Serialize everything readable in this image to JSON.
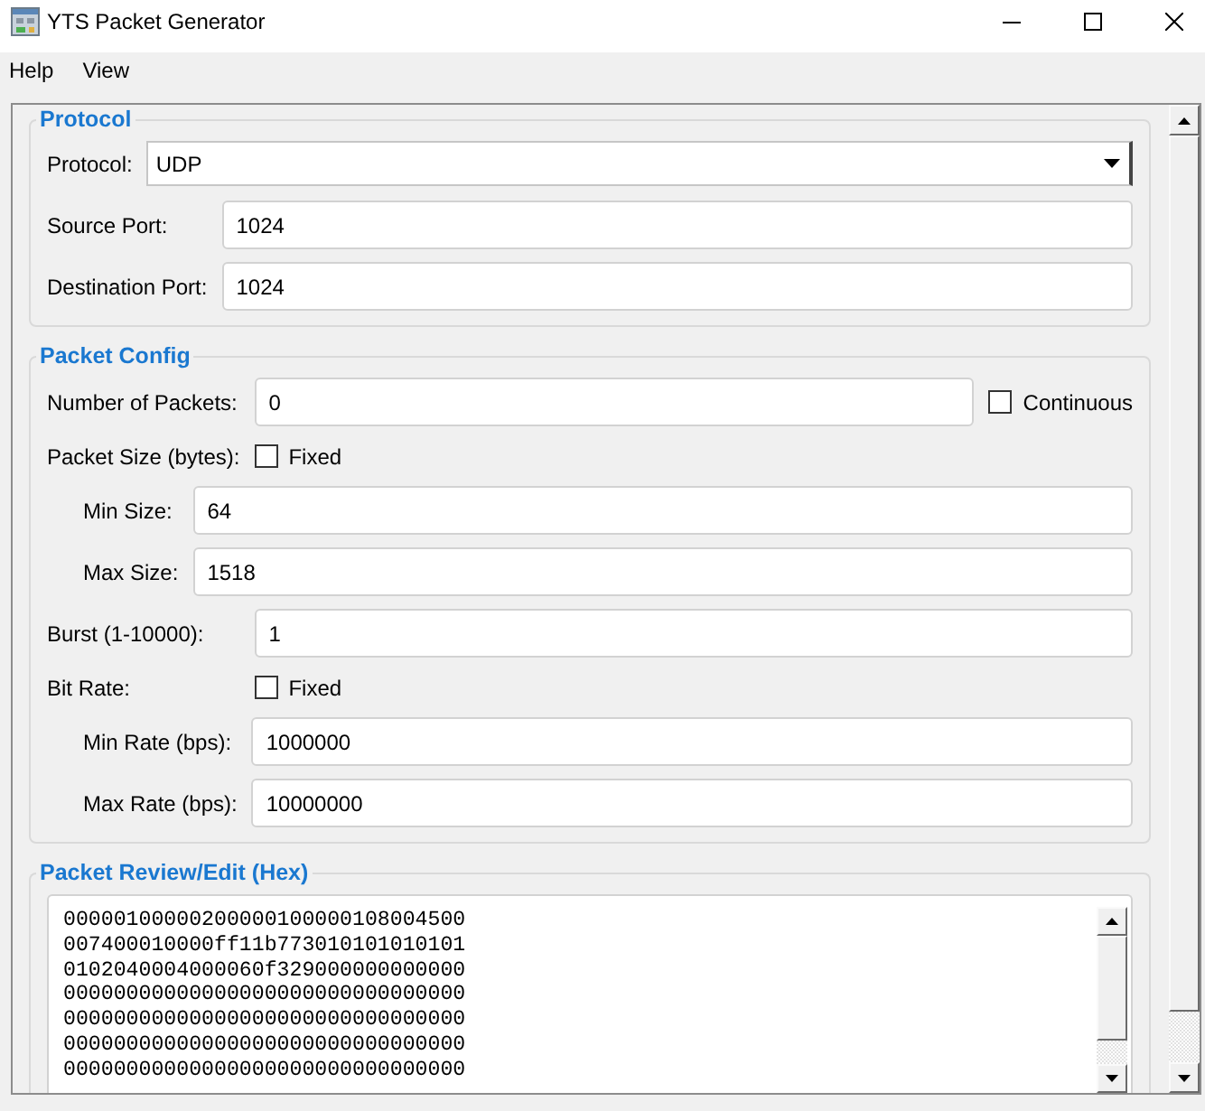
{
  "window": {
    "title": "YTS Packet Generator"
  },
  "menu": [
    {
      "label": "Help"
    },
    {
      "label": "View"
    }
  ],
  "groups": [
    {
      "title": "Protocol",
      "rows": [
        {
          "kind": "select",
          "label": "Protocol:",
          "value": "UDP"
        },
        {
          "kind": "field",
          "label": "Source Port:",
          "value": "1024"
        },
        {
          "kind": "field",
          "label": "Destination Port:",
          "value": "1024"
        }
      ]
    },
    {
      "title": "Packet Config",
      "rows": [
        {
          "kind": "field",
          "label": "Number of Packets:",
          "value": "0",
          "check": {
            "label": "Continuous",
            "checked": false
          }
        },
        {
          "kind": "check",
          "label": "Packet Size (bytes):",
          "check": {
            "label": "Fixed",
            "checked": false
          },
          "children": [
            {
              "kind": "field",
              "label": "Min Size:",
              "value": "64"
            },
            {
              "kind": "field",
              "label": "Max Size:",
              "value": "1518"
            }
          ]
        },
        {
          "kind": "field",
          "label": "Burst (1-10000):",
          "value": "1"
        },
        {
          "kind": "check",
          "label": "Bit Rate:",
          "check": {
            "label": "Fixed",
            "checked": false
          },
          "children": [
            {
              "kind": "field",
              "label": "Min Rate (bps):",
              "value": "1000000"
            },
            {
              "kind": "field",
              "label": "Max Rate (bps):",
              "value": "10000000"
            }
          ]
        }
      ]
    },
    {
      "title": "Packet Review/Edit (Hex)",
      "rows": [
        {
          "kind": "hex",
          "lines": [
            "00000100000200000100000108004500",
            "007400010000ff11b773010101010101",
            "0102040004000060f329000000000000",
            "00000000000000000000000000000000",
            "00000000000000000000000000000000",
            "00000000000000000000000000000000",
            "00000000000000000000000000000000"
          ]
        }
      ]
    }
  ]
}
